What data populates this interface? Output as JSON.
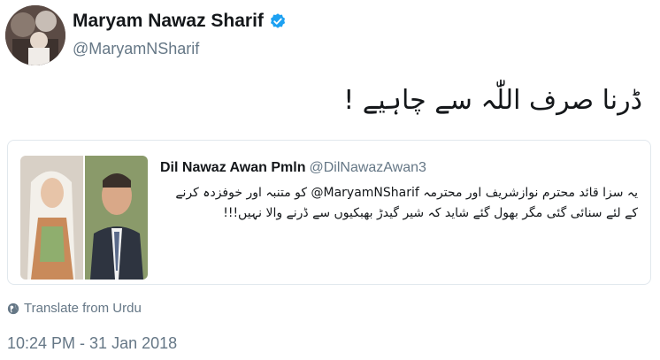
{
  "author": {
    "name": "Maryam Nawaz Sharif",
    "handle": "@MaryamNSharif",
    "verified": true
  },
  "tweet": {
    "text": "ڈرنا صرف اللّٰہ سے چاہیے !"
  },
  "quoted_tweet": {
    "name": "Dil Nawaz Awan Pmln",
    "handle": "@DilNawazAwan3",
    "text": "یہ سزا قائد محترم نوازشریف اور محترمہ MaryamNSharif@ کو متنبہ اور خوفزدہ کرنے کے لئے سنائی گئی مگر بھول گئے شاید کہ شیر گیدڑ بھبکیوں سے ڈرنے والا نہیں!!!"
  },
  "translate_label": "Translate from Urdu",
  "timestamp": "10:24 PM - 31 Jan 2018",
  "colors": {
    "text": "#14171a",
    "secondary": "#657786",
    "verified_badge": "#1da1f2",
    "border": "#e1e8ed"
  }
}
